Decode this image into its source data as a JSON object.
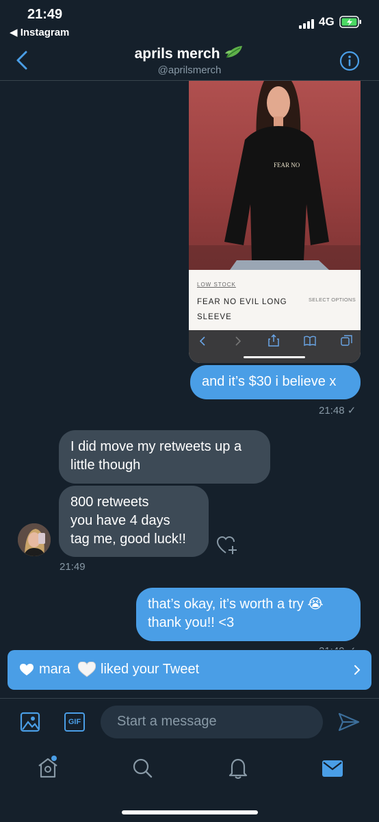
{
  "status_bar": {
    "time": "21:49",
    "back_app": "◀ Instagram",
    "network": "4G"
  },
  "header": {
    "title": "aprils merch",
    "handle": "@aprilsmerch"
  },
  "product_card": {
    "badge": "LOW STOCK",
    "name_line1": "FEAR NO EVIL LONG",
    "name_line2": "SLEEVE",
    "select_options": "SELECT OPTIONS",
    "shirt_print": "FEAR NO"
  },
  "messages": [
    {
      "direction": "outgoing",
      "text": "and it’s $30 i believe x",
      "time": "21:48 ✓"
    },
    {
      "direction": "incoming",
      "text_line1": "I did move my retweets up a",
      "text_line2": "little though"
    },
    {
      "direction": "incoming",
      "text_line1": "800 retweets",
      "text_line2": "you have 4 days",
      "text_line3": "tag me, good luck!!",
      "time": "21:49"
    },
    {
      "direction": "outgoing",
      "text_line1": "that’s okay, it’s worth a try 😭",
      "text_line2": "thank you!! <3",
      "time": "21:49 ✓"
    }
  ],
  "toast": {
    "prefix": "mara",
    "suffix": "liked your Tweet"
  },
  "composer": {
    "placeholder": "Start a message",
    "gif_label": "GIF"
  },
  "colors": {
    "background": "#15202b",
    "accent": "#4a9ee6",
    "incoming_bubble": "#3d4a56",
    "muted": "#8899a6"
  },
  "icons": [
    "back-chevron-icon",
    "info-icon",
    "image-icon",
    "gif-icon",
    "send-icon",
    "home-icon",
    "search-icon",
    "bell-icon",
    "mail-icon",
    "heart-add-icon"
  ]
}
